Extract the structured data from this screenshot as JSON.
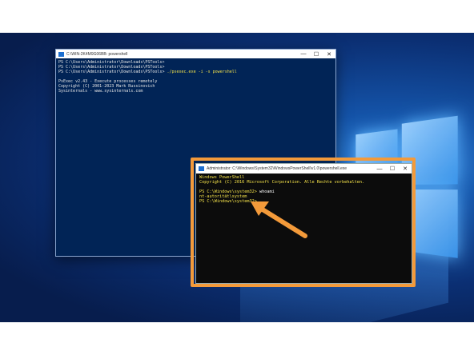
{
  "desktop": {
    "accent": "#0b2f73"
  },
  "powershell_window": {
    "title": "C:\\WIN-2K4M9G06BB: powershell",
    "controls": {
      "minimize": "—",
      "maximize": "☐",
      "close": "✕"
    },
    "lines": [
      {
        "prompt": "PS C:\\Users\\Administrator\\Downloads\\PSTools>",
        "cmd": ""
      },
      {
        "prompt": "PS C:\\Users\\Administrator\\Downloads\\PSTools>",
        "cmd": ""
      },
      {
        "prompt": "PS C:\\Users\\Administrator\\Downloads\\PSTools>",
        "cmd": " ./psexec.exe -i -s powershell"
      }
    ],
    "output": [
      "PsExec v2.43 - Execute processes remotely",
      "Copyright (C) 2001-2023 Mark Russinovich",
      "Sysinternals - www.sysinternals.com"
    ]
  },
  "cmd_window": {
    "title": "Administrator: C:\\Windows\\System32\\WindowsPowerShell\\v1.0\\powershell.exe",
    "controls": {
      "minimize": "—",
      "maximize": "☐",
      "close": "✕"
    },
    "header": "Windows PowerShell",
    "copyright": "Copyright (C) 2016 Microsoft Corporation. Alle Rechte vorbehalten.",
    "line1_prompt": "PS C:\\Windows\\system32>",
    "line1_cmd": " whoami",
    "line2": "nt-autorität\\system",
    "line3_prompt": "PS C:\\Windows\\system32>"
  },
  "highlight_color": "#f39a3a"
}
